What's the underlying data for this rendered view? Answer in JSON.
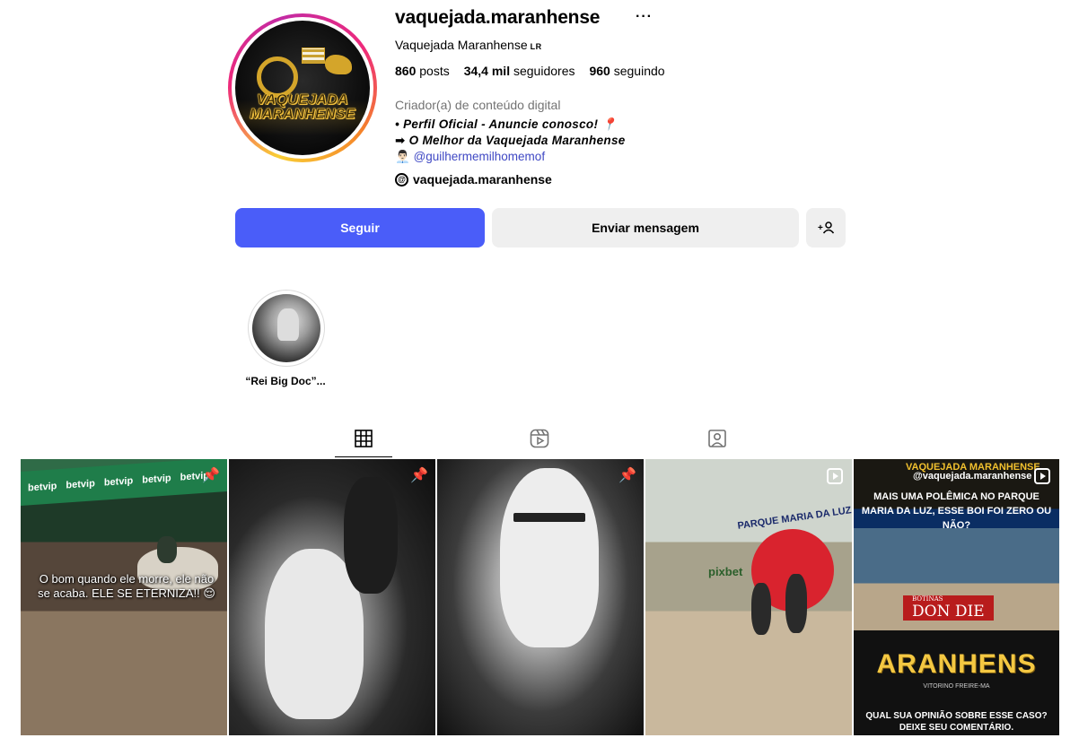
{
  "profile": {
    "username": "vaquejada.maranhense",
    "full_name": "Vaquejada Maranhense",
    "pronoun_badge": "LR",
    "category": "Criador(a) de conteúdo digital",
    "avatar_logo_line1": "VAQUEJADA",
    "avatar_logo_line2": "MARANHENSE",
    "threads_handle": "vaquejada.maranhense"
  },
  "stats": {
    "posts_count": "860",
    "posts_label": "posts",
    "followers_count": "34,4 mil",
    "followers_label": "seguidores",
    "following_count": "960",
    "following_label": "seguindo"
  },
  "bio": {
    "line1": "• Perfil Oficial - Anuncie conosco! 📍",
    "line2": "➡ O Melhor da Vaquejada Maranhense",
    "mention_prefix": "👨🏻‍💼 ",
    "mention": "@guilhermemilhomemof"
  },
  "actions": {
    "follow_label": "Seguir",
    "message_label": "Enviar mensagem",
    "suggest_icon": "person-add-icon"
  },
  "highlights": [
    {
      "label": "“Rei Big Doc”..."
    }
  ],
  "tabs": [
    {
      "icon": "grid-icon",
      "active": true
    },
    {
      "icon": "reels-icon",
      "active": false
    },
    {
      "icon": "tagged-icon",
      "active": false
    }
  ],
  "posts": {
    "p1": {
      "sponsor": "betvip",
      "caption": "O bom quando ele morre, ele não se acaba. ELE SE ETERNIZA!! 😌",
      "pinned": true
    },
    "p2": {
      "pinned": true
    },
    "p3": {
      "pinned": true
    },
    "p4": {
      "sign": "PARQUE MARIA DA LUZ",
      "sponsor": "pixbet",
      "reel": true
    },
    "p5": {
      "header": "VAQUEJADA MARANHENSE",
      "handle": "@vaquejada.maranhense",
      "question": "MAIS UMA POLÊMICA NO PARQUE MARIA DA LUZ, ESSE BOI FOI ZERO OU NÃO?",
      "banner": "DON DIE",
      "banner_top": "BOTINAS",
      "big_text": "ARANHENS",
      "subtitle": "VITORINO FREIRE-MA",
      "footer": "QUAL SUA OPINIÃO SOBRE ESSE CASO? DEIXE SEU COMENTÁRIO.",
      "reel": true
    }
  },
  "colors": {
    "follow_button": "#4a5df9",
    "secondary_button": "#efefef",
    "link": "#3f48c4",
    "muted_text": "#737373"
  }
}
